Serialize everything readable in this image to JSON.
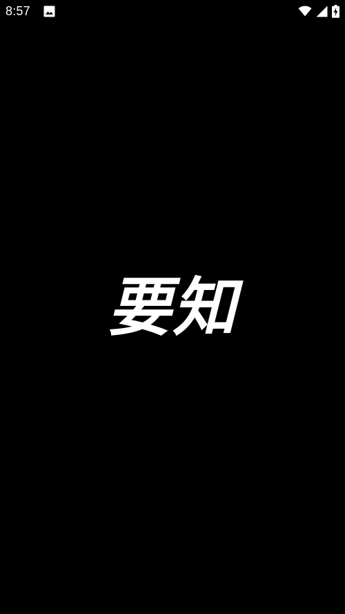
{
  "status_bar": {
    "time": "8:57",
    "icons": [
      "image-icon",
      "wifi-icon",
      "cell-signal-icon",
      "battery-charging-icon"
    ]
  },
  "splash": {
    "logo_text": "要知"
  },
  "colors": {
    "background": "#000000",
    "foreground": "#ffffff"
  }
}
